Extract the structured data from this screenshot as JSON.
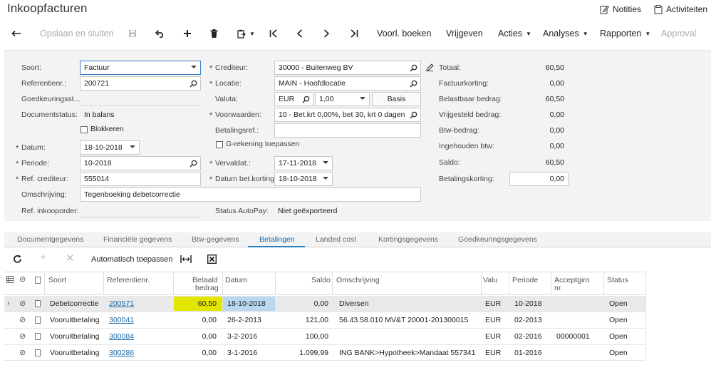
{
  "window": {
    "title": "Inkoopfacturen"
  },
  "top_links": {
    "notes": "Notities",
    "activities": "Activiteiten"
  },
  "toolbar": {
    "save_close": "Opslaan en sluiten",
    "preview": "Voorl. boeken",
    "release": "Vrijgeven",
    "actions": "Acties",
    "analyses": "Analyses",
    "reports": "Rapporten",
    "approval": "Approval"
  },
  "form": {
    "soort_label": "Soort:",
    "soort_value": "Factuur",
    "ref_label": "Referentienr.:",
    "ref_value": "200721",
    "goedkeuring_label": "Goedkeuringsst...",
    "docstatus_label": "Documentstatus:",
    "docstatus_value": "In balans",
    "blokkeren_label": "Blokkeren",
    "datum_label": "Datum:",
    "datum_value": "18-10-2018",
    "periode_label": "Periode:",
    "periode_value": "10-2018",
    "refcred_label": "Ref. crediteur:",
    "refcred_value": "555014",
    "omschrijving_label": "Omschrijving:",
    "omschrijving_value": "Tegenboeking debetcorrectie",
    "refinkoop_label": "Ref. inkooporder:",
    "crediteur_label": "Crediteur:",
    "crediteur_value": "30000 - Buitenweg BV",
    "locatie_label": "Locatie:",
    "locatie_value": "MAIN - Hoofdlocatie",
    "valuta_label": "Valuta:",
    "valuta_value": "EUR",
    "valuta_rate": "1,00",
    "basis_label": "Basis",
    "voorwaarden_label": "Voorwaarden:",
    "voorwaarden_value": "10 - Bet.krt 0,00%, bet 30, krt 0 dagen",
    "betalingsref_label": "Betalingsref.:",
    "grekening_label": "G-rekening toepassen",
    "vervaldat_label": "Vervaldat.:",
    "vervaldat_value": "17-11-2018",
    "datumbet_label": "Datum bet.korting:",
    "datumbet_value": "18-10-2018",
    "autopay_label": "Status AutoPay:",
    "autopay_value": "Niet geëxporteerd"
  },
  "totals": {
    "totaal_label": "Totaal:",
    "totaal": "60,50",
    "factuurkorting_label": "Factuurkorting:",
    "factuurkorting": "0,00",
    "belastbaar_label": "Belastbaar bedrag:",
    "belastbaar": "60,50",
    "vrijgesteld_label": "Vrijgesteld bedrag:",
    "vrijgesteld": "0,00",
    "btw_label": "Btw-bedrag:",
    "btw": "0,00",
    "ingehouden_label": "Ingehouden btw:",
    "ingehouden": "0,00",
    "saldo_label": "Saldo:",
    "saldo": "60,50",
    "betalingskorting_label": "Betalingskorting:",
    "betalingskorting": "0,00"
  },
  "tabs": [
    "Documentgegevens",
    "Financiële gegevens",
    "Btw-gegevens",
    "Betalingen",
    "Landed cost",
    "Kortingsgegevens",
    "Goedkeuringsgegevens"
  ],
  "grid_toolbar": {
    "auto_apply": "Automatisch toepassen"
  },
  "columns": {
    "soort": "Soort",
    "ref": "Referentienr.",
    "betaald1": "Betaald",
    "betaald2": "bedrag",
    "datum": "Datum",
    "saldo": "Saldo",
    "omschrijving": "Omschrijving",
    "valuta": "Valu",
    "periode": "Periode",
    "acceptgiro1": "Acceptgiro",
    "acceptgiro2": "nr.",
    "status": "Status"
  },
  "rows": [
    {
      "soort": "Debetcorrectie",
      "ref": "200571",
      "betaald": "60,50",
      "datum": "18-10-2018",
      "saldo": "0,00",
      "omschrijving": "Diversen",
      "valuta": "EUR",
      "periode": "10-2018",
      "acceptgiro": "",
      "status": "Open"
    },
    {
      "soort": "Vooruitbetaling",
      "ref": "300041",
      "betaald": "0,00",
      "datum": "26-2-2013",
      "saldo": "121,00",
      "omschrijving": "56.43.58.010 MV&T 20001-201300015",
      "valuta": "EUR",
      "periode": "02-2013",
      "acceptgiro": "",
      "status": "Open"
    },
    {
      "soort": "Vooruitbetaling",
      "ref": "300084",
      "betaald": "0,00",
      "datum": "3-2-2016",
      "saldo": "100,00",
      "omschrijving": "",
      "valuta": "EUR",
      "periode": "02-2016",
      "acceptgiro": "00000001",
      "status": "Open"
    },
    {
      "soort": "Vooruitbetaling",
      "ref": "300286",
      "betaald": "0,00",
      "datum": "3-1-2016",
      "saldo": "1.099,99",
      "omschrijving": "ING BANK>Hypotheek>Mandaat 557341",
      "valuta": "EUR",
      "periode": "01-2016",
      "acceptgiro": "",
      "status": "Open"
    }
  ],
  "colors": {
    "accent": "#2a7fc1",
    "highlight_yellow": "#e2e600",
    "selected_date": "#b9d7ee"
  }
}
